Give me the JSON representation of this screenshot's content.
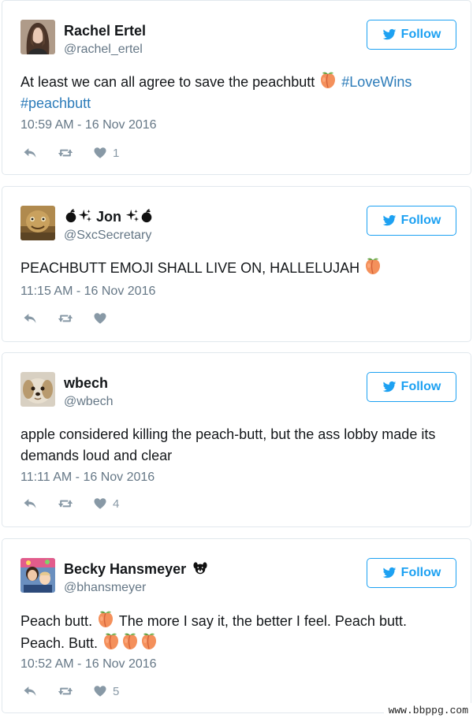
{
  "tweets": [
    {
      "display_name": "Rachel Ertel",
      "handle": "@rachel_ertel",
      "text_a": "At least we can all agree to save the peachbutt",
      "hashtag_1": "#LoveWins",
      "hashtag_2": "#peachbutt",
      "timestamp": "10:59 AM - 16 Nov 2016",
      "likes": "1",
      "follow_label": "Follow"
    },
    {
      "display_name_text": "Jon",
      "handle": "@SxcSecretary",
      "text": "PEACHBUTT EMOJI SHALL LIVE ON, HALLELUJAH",
      "timestamp": "11:15 AM - 16 Nov 2016",
      "likes": "",
      "follow_label": "Follow"
    },
    {
      "display_name": "wbech",
      "handle": "@wbech",
      "text": "apple considered killing the peach-butt, but the ass lobby made its demands loud and clear",
      "timestamp": "11:11 AM - 16 Nov 2016",
      "likes": "4",
      "follow_label": "Follow"
    },
    {
      "display_name": "Becky Hansmeyer",
      "handle": "@bhansmeyer",
      "text_a": "Peach butt.",
      "text_b": "The more I say it, the better I feel. Peach butt. Peach. Butt.",
      "timestamp": "10:52 AM - 16 Nov 2016",
      "likes": "5",
      "follow_label": "Follow"
    }
  ],
  "watermark": "www.bbppg.com",
  "colors": {
    "twitter_blue": "#1da1f2",
    "hashtag": "#2b7bb9",
    "muted": "#657786",
    "action_gray": "#8899a6",
    "border": "#e1e8ed"
  },
  "icons": {
    "follow": "twitter-bird-icon",
    "reply": "reply-icon",
    "retweet": "retweet-icon",
    "like": "heart-icon",
    "emoji": "peach-emoji-icon"
  }
}
